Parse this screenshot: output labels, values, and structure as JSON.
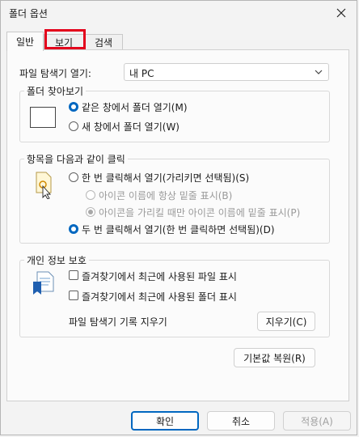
{
  "window": {
    "title": "폴더 옵션"
  },
  "tabs": [
    {
      "label": "일반",
      "active": true
    },
    {
      "label": "보기",
      "highlighted": true
    },
    {
      "label": "검색"
    }
  ],
  "explorer_open": {
    "label": "파일 탐색기 열기:",
    "value": "내 PC"
  },
  "browse_folders": {
    "title": "폴더 찾아보기",
    "options": [
      {
        "label": "같은 창에서 폴더 열기(M)",
        "selected": true
      },
      {
        "label": "새 창에서 폴더 열기(W)",
        "selected": false
      }
    ]
  },
  "click_items": {
    "title": "항목을 다음과 같이 클릭",
    "options": [
      {
        "label": "한 번 클릭해서 열기(가리키면 선택됨)(S)",
        "selected": false
      },
      {
        "label": "아이콘 이름에 항상 밑줄 표시(B)",
        "selected": false,
        "disabled": true
      },
      {
        "label": "아이콘을 가리킬 때만 아이콘 이름에 밑줄 표시(P)",
        "selected": true,
        "disabled": true
      },
      {
        "label": "두 번 클릭해서 열기(한 번 클릭하면 선택됨)(D)",
        "selected": true
      }
    ]
  },
  "privacy": {
    "title": "개인 정보 보호",
    "checks": [
      {
        "label": "즐겨찾기에서 최근에 사용된 파일 표시",
        "checked": false
      },
      {
        "label": "즐겨찾기에서 최근에 사용된 폴더 표시",
        "checked": false
      }
    ],
    "clear_label": "파일 탐색기 기록 지우기",
    "clear_button": "지우기(C)"
  },
  "restore_button": "기본값 복원(R)",
  "footer": {
    "ok": "확인",
    "cancel": "취소",
    "apply": "적용(A)"
  },
  "colors": {
    "accent": "#0067c0",
    "highlight": "#e3001b"
  }
}
